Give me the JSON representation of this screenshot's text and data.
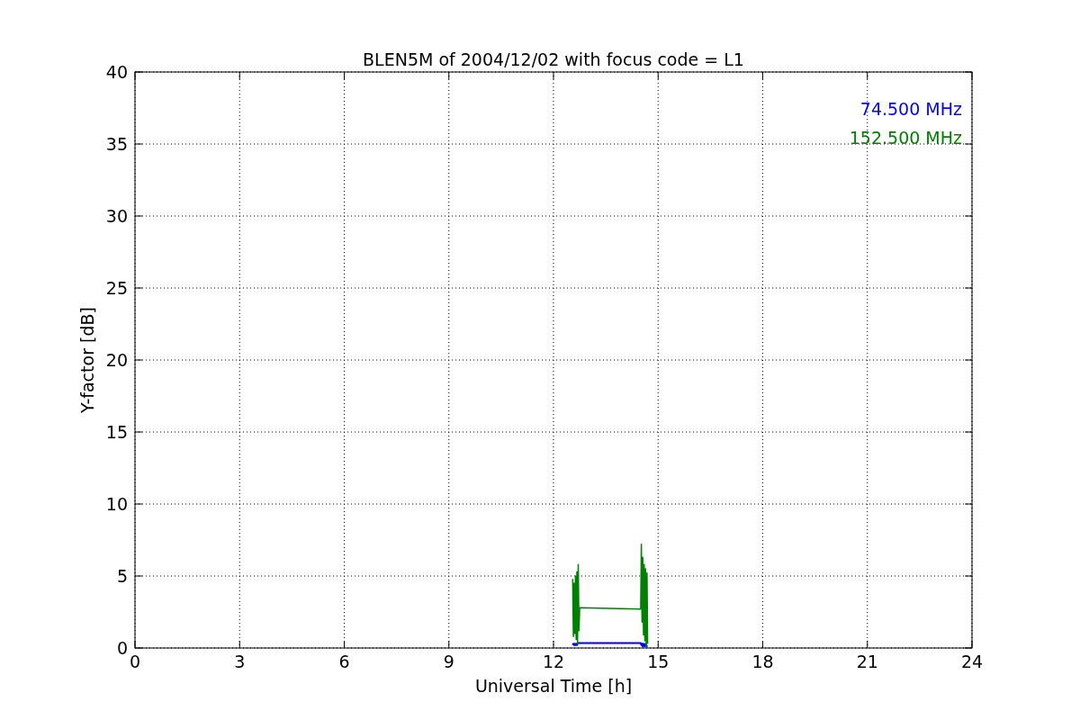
{
  "chart_data": {
    "type": "line",
    "title": "BLEN5M of 2004/12/02 with focus code = L1",
    "xlabel": "Universal Time [h]",
    "ylabel": "Y-factor [dB]",
    "x": [
      12.55,
      12.57,
      12.59,
      12.61,
      12.63,
      12.65,
      12.67,
      12.69,
      12.71,
      12.73,
      12.75,
      14.5,
      14.52,
      14.54,
      14.56,
      14.58,
      14.6,
      14.62,
      14.64,
      14.66,
      14.68,
      14.7
    ],
    "series": [
      {
        "name": "74.500 MHz",
        "color": "#0000ff",
        "values": [
          0.2,
          0.3,
          0.2,
          0.3,
          0.2,
          0.3,
          0.2,
          0.3,
          0.35,
          0.35,
          0.35,
          0.35,
          0.2,
          0.3,
          0.1,
          0.3,
          0.2,
          0.1,
          0.3,
          0.2,
          0.1,
          0.1
        ]
      },
      {
        "name": "152.500 MHz",
        "color": "#008000",
        "values": [
          4.8,
          0.8,
          4.5,
          1.0,
          5.0,
          0.6,
          5.3,
          0.3,
          5.8,
          1.2,
          2.8,
          2.7,
          7.2,
          1.8,
          6.3,
          0.9,
          5.8,
          0.5,
          5.5,
          0.1,
          5.2,
          0.3
        ]
      }
    ],
    "grid": true,
    "xlim": [
      0,
      24
    ],
    "ylim": [
      0,
      40
    ],
    "xticks": [
      0,
      3,
      6,
      9,
      12,
      15,
      18,
      21,
      24
    ],
    "yticks": [
      0,
      5,
      10,
      15,
      20,
      25,
      30,
      35,
      40
    ]
  }
}
